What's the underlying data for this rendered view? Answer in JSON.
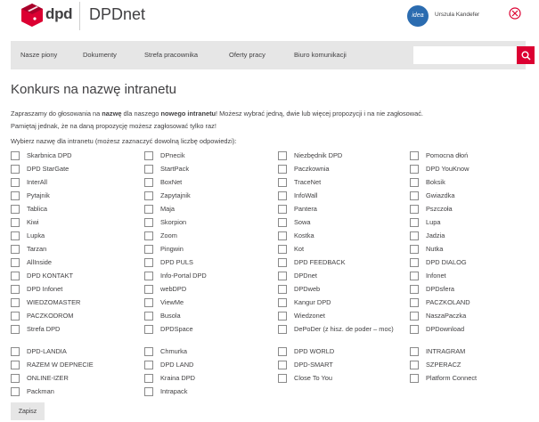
{
  "header": {
    "brand": "dpd",
    "app_name": "DPDnet",
    "avatar_text": "idea",
    "user_name": "Urszula Kandefer"
  },
  "nav": {
    "items": [
      "Nasze piony",
      "Dokumenty",
      "Strefa pracownika",
      "Oferty pracy",
      "Biuro komunikacji"
    ],
    "search_value": ""
  },
  "page": {
    "title": "Konkurs na nazwę intranetu",
    "intro_a": "Zapraszamy do głosowania na ",
    "intro_b": "nazwę",
    "intro_c": " dla naszego ",
    "intro_d": "nowego intranetu",
    "intro_e": "! Możesz wybrać jedną, dwie lub więcej propozycji i na nie zagłosować.",
    "intro_f": "Pamiętaj jednak, że na daną propozycję możesz zagłosować tylko raz!",
    "question": "Wybierz nazwę dla intranetu (możesz zaznaczyć dowolną liczbę odpowiedzi):",
    "submit_label": "Zapisz"
  },
  "options": [
    [
      "Skarbnica DPD",
      "DPnecik",
      "Niezbędnik DPD",
      "Pomocna dłoń"
    ],
    [
      "DPD StarGate",
      "StartPack",
      "Paczkownia",
      "DPD YouKnow"
    ],
    [
      "InterAll",
      "BoxNet",
      "TraceNet",
      "Boksik"
    ],
    [
      "Pytajnik",
      "Zapytajnik",
      "InfoWall",
      "Gwiazdka"
    ],
    [
      "Tablica",
      "Maja",
      "Pantera",
      "Pszczoła"
    ],
    [
      "Kiwi",
      "Skorpion",
      "Sowa",
      "Lupa"
    ],
    [
      "Lupka",
      "Zoom",
      "Kostka",
      "Jadzia"
    ],
    [
      "Tarzan",
      "Pingwin",
      "Kot",
      "Nutka"
    ],
    [
      "AllInside",
      "DPD PULS",
      "DPD FEEDBACK",
      "DPD DIALOG"
    ],
    [
      "DPD KONTAKT",
      "Info-Portal DPD",
      "DPDnet",
      "Infonet"
    ],
    [
      "DPD Infonet",
      "webDPD",
      "DPDweb",
      "DPDsfera"
    ],
    [
      "WIEDZOMASTER",
      "ViewMe",
      "Kangur DPD",
      "PACZKOLAND"
    ],
    [
      "PACZKODROM",
      "Busola",
      "Wiedzonet",
      "NaszaPaczka"
    ],
    [
      "Strefa DPD",
      "DPDSpace",
      "DePoDer (z hisz. de poder – moc)",
      "DPDownload"
    ],
    [
      "DPD-LANDIA",
      "Chmurka",
      "DPD WORLD",
      "INTRAGRAM"
    ],
    [
      "RAZEM W DEPNECIE",
      "DPD LAND",
      "DPD-SMART",
      "SZPERACZ"
    ],
    [
      "ONLINE-IZER",
      "Kraina DPD",
      "Close To You",
      "Platform Connect"
    ],
    [
      "Packman",
      "Intrapack",
      "",
      ""
    ]
  ]
}
